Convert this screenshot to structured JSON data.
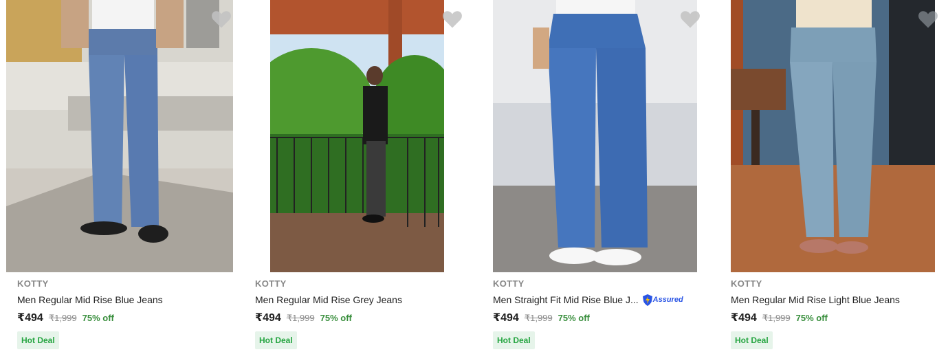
{
  "products": [
    {
      "brand": "KOTTY",
      "title": "Men Regular Mid Rise Blue Jeans",
      "price": "₹494",
      "mrp": "₹1,999",
      "discount": "75% off",
      "badge": "Hot Deal",
      "assured": false,
      "image_alt": "Men Regular Mid Rise Blue Jeans"
    },
    {
      "brand": "KOTTY",
      "title": "Men Regular Mid Rise Grey Jeans",
      "price": "₹494",
      "mrp": "₹1,999",
      "discount": "75% off",
      "badge": "Hot Deal",
      "assured": false,
      "image_alt": "Men Regular Mid Rise Grey Jeans"
    },
    {
      "brand": "KOTTY",
      "title": "Men Straight Fit Mid Rise Blue J...",
      "price": "₹494",
      "mrp": "₹1,999",
      "discount": "75% off",
      "badge": "Hot Deal",
      "assured": true,
      "assured_label": "Assured",
      "image_alt": "Men Straight Fit Mid Rise Blue Jeans"
    },
    {
      "brand": "KOTTY",
      "title": "Men Regular Mid Rise Light Blue Jeans",
      "price": "₹494",
      "mrp": "₹1,999",
      "discount": "75% off",
      "badge": "Hot Deal",
      "assured": false,
      "image_alt": "Men Regular Mid Rise Light Blue Jeans"
    }
  ],
  "icons": {
    "wishlist": "heart-icon",
    "assured": "assured-badge-icon"
  },
  "colors": {
    "brand_text": "#878787",
    "title_text": "#212121",
    "discount": "#388e3c",
    "deal_bg": "#e6f4ea",
    "deal_text": "#26a541",
    "assured": "#2a55e5",
    "heart": "#c2c2c2"
  }
}
